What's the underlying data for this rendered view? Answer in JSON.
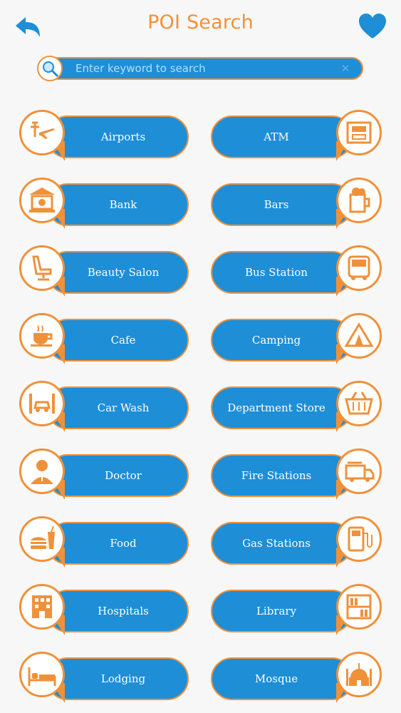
{
  "header": {
    "title": "POI Search",
    "back_icon": "back-arrow-icon",
    "favorite_icon": "heart-icon"
  },
  "search": {
    "placeholder": "Enter keyword to search",
    "value": "",
    "icon": "search-icon",
    "clear_icon": "clear-icon"
  },
  "colors": {
    "accent": "#f0913a",
    "primary": "#1e8ed7",
    "background": "#f7f7f7"
  },
  "categories": [
    {
      "label": "Airports",
      "icon": "airport-icon"
    },
    {
      "label": "ATM",
      "icon": "atm-icon"
    },
    {
      "label": "Bank",
      "icon": "bank-icon"
    },
    {
      "label": "Bars",
      "icon": "beer-mug-icon"
    },
    {
      "label": "Beauty Salon",
      "icon": "salon-chair-icon"
    },
    {
      "label": "Bus Station",
      "icon": "bus-icon"
    },
    {
      "label": "Cafe",
      "icon": "coffee-cup-icon"
    },
    {
      "label": "Camping",
      "icon": "tent-icon"
    },
    {
      "label": "Car Wash",
      "icon": "car-wash-icon"
    },
    {
      "label": "Department Store",
      "icon": "shopping-basket-icon"
    },
    {
      "label": "Doctor",
      "icon": "doctor-icon"
    },
    {
      "label": "Fire Stations",
      "icon": "fire-truck-icon"
    },
    {
      "label": "Food",
      "icon": "burger-drink-icon"
    },
    {
      "label": "Gas Stations",
      "icon": "gas-pump-icon"
    },
    {
      "label": "Hospitals",
      "icon": "hospital-icon"
    },
    {
      "label": "Library",
      "icon": "bookshelf-icon"
    },
    {
      "label": "Lodging",
      "icon": "bed-icon"
    },
    {
      "label": "Mosque",
      "icon": "mosque-icon"
    }
  ]
}
